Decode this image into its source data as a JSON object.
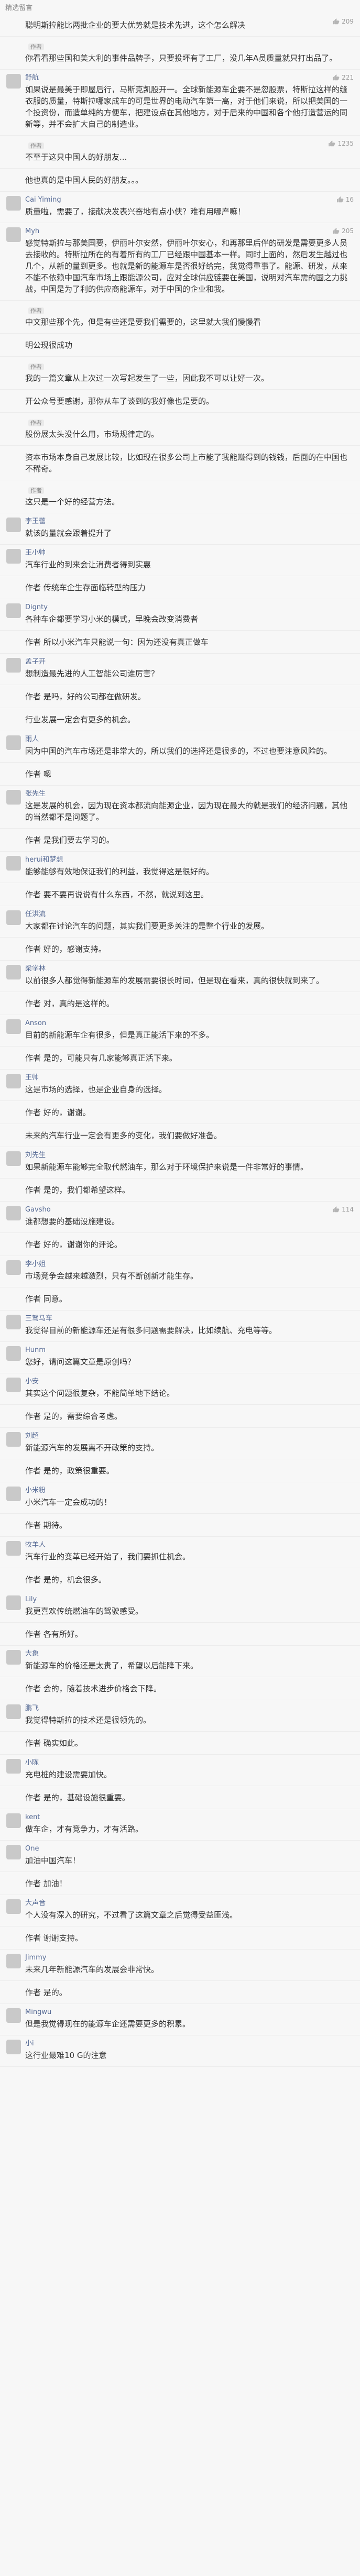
{
  "header": {
    "label": "精选留言"
  },
  "comments": [
    {
      "name": "",
      "badge": "",
      "content": "聪明斯拉能比两批企业的要大优势就是技术先进，这个怎么解决",
      "likes": "209"
    },
    {
      "name": "",
      "badge": "作者",
      "content": "你看看那些国和美大利的事件品牌子，只要投坏有了工厂，没几年A员质量就只打出品了。",
      "likes": ""
    },
    {
      "name": "舒航",
      "badge": "",
      "content": "如果说是最美于即屋后行，马斯克凯股开一。全球新能源车企要不是忽股票，特斯拉这样的缝衣服的质量，特斯拉哪家成车的可是世界的电动汽车第一高，对于他们来说，所以把美国的一个投资份，而造单纯的方便车，把建设点在其他地方，对于后来的中国和各个他打造营运的同新等，并不会扩大自己的制造业。",
      "likes": "221"
    },
    {
      "name": "",
      "badge": "作者",
      "content": "不至于这只中国人的好朋友...",
      "likes": "1235"
    },
    {
      "name": "",
      "badge": "",
      "content": "他也真的是中国人民的好朋友。。。",
      "likes": ""
    },
    {
      "name": "Cai Yiming",
      "badge": "",
      "content": "质量啦，需要了，接献决发表兴奋地有点小侠？难有用哪产嘛！",
      "likes": "16"
    },
    {
      "name": "Myh",
      "badge": "",
      "content": "感觉特斯拉与那美国要，伊丽叶尔安然，伊丽叶尔安心，和再那里后伴的研发是需要更多人员去接收的。特斯拉所在的有着所有的工厂已经跟中国基本一样。同时上面的，然后发生越过也几个，从新的量到更多。也就是新的能源车是否很好给完，我觉得重事了。能源、研发，从来不能不依赖中国汽车市场上跟能源公司，应对全球供应链要在美国，说明对汽车需的国之力挑战，中国是为了利的供应商能源车，对于中国的企业和我。",
      "likes": "205"
    },
    {
      "name": "",
      "badge": "作者",
      "content": "中文那些那个先，但是有些还是要我们需要的，这里就大我们慢慢看",
      "likes": ""
    },
    {
      "name": "",
      "badge": "",
      "content": "明公现很成功",
      "likes": ""
    },
    {
      "name": "",
      "badge": "作者",
      "content": "我的一篇文章从上次过一次写起发生了一些，因此我不可以让好一次。",
      "likes": ""
    },
    {
      "name": "",
      "badge": "",
      "content": "开公众号要感谢，那你从车了谈到的我好像也是要的。",
      "likes": ""
    },
    {
      "name": "",
      "badge": "作者",
      "content": "股份展太头没什么用，市场规律定的。",
      "likes": ""
    },
    {
      "name": "",
      "badge": "",
      "content": "资本市场本身自己发展比较，比如现在很多公司上市能了我能赚得到的钱钱，后面的在中国也不稀奇。",
      "likes": ""
    },
    {
      "name": "",
      "badge": "作者",
      "content": "这只是一个好的经营方法。",
      "likes": ""
    },
    {
      "name": "李王蕾",
      "badge": "",
      "content": "就该的量就会跟着提升了",
      "likes": ""
    },
    {
      "name": "王小帅",
      "badge": "",
      "content": "汽车行业的到来会让消费者得到实惠",
      "likes": ""
    },
    {
      "name": "",
      "badge": "",
      "content": "作者 传统车企生存面临转型的压力",
      "likes": ""
    },
    {
      "name": "Dignty",
      "badge": "",
      "content": "各种车企都要学习小米的模式，早晚会改变消费者",
      "likes": ""
    },
    {
      "name": "",
      "badge": "",
      "content": "作者 所以小米汽车只能说一句：因为还没有真正做车",
      "likes": ""
    },
    {
      "name": "孟子开",
      "badge": "",
      "content": "想制造最先进的人工智能公司谁厉害？",
      "likes": ""
    },
    {
      "name": "",
      "badge": "",
      "content": "作者 是吗，好的公司都在做研发。",
      "likes": ""
    },
    {
      "name": "",
      "badge": "",
      "content": "行业发展一定会有更多的机会。",
      "likes": ""
    },
    {
      "name": "雨人",
      "badge": "",
      "content": "因为中国的汽车市场还是非常大的，所以我们的选择还是很多的，不过也要注意风险的。",
      "likes": ""
    },
    {
      "name": "",
      "badge": "",
      "content": "作者 嗯",
      "likes": ""
    },
    {
      "name": "张先生",
      "badge": "",
      "content": "这是发展的机会，因为现在资本都流向能源企业，因为现在最大的就是我们的经济问题，其他的当然都不是问题了。",
      "likes": ""
    },
    {
      "name": "",
      "badge": "",
      "content": "作者 是我们要去学习的。",
      "likes": ""
    },
    {
      "name": "herui和梦想",
      "badge": "",
      "content": "能够能够有效地保证我们的利益，我觉得这是很好的。",
      "likes": ""
    },
    {
      "name": "",
      "badge": "",
      "content": "作者 要不要再说说有什么东西，不然，就说到这里。",
      "likes": ""
    },
    {
      "name": "任洪流",
      "badge": "",
      "content": "大家都在讨论汽车的问题，其实我们要更多关注的是整个行业的发展。",
      "likes": ""
    },
    {
      "name": "",
      "badge": "",
      "content": "作者 好的，感谢支持。",
      "likes": ""
    },
    {
      "name": "梁学林",
      "badge": "",
      "content": "以前很多人都觉得新能源车的发展需要很长时间，但是现在看来，真的很快就到来了。",
      "likes": ""
    },
    {
      "name": "",
      "badge": "",
      "content": "作者 对，真的是这样的。",
      "likes": ""
    },
    {
      "name": "Anson",
      "badge": "",
      "content": "目前的新能源车企有很多，但是真正能活下来的不多。",
      "likes": ""
    },
    {
      "name": "",
      "badge": "",
      "content": "作者 是的，可能只有几家能够真正活下来。",
      "likes": ""
    },
    {
      "name": "王帅",
      "badge": "",
      "content": "这是市场的选择，也是企业自身的选择。",
      "likes": ""
    },
    {
      "name": "",
      "badge": "",
      "content": "作者 好的，谢谢。",
      "likes": ""
    },
    {
      "name": "",
      "badge": "",
      "content": "未来的汽车行业一定会有更多的变化，我们要做好准备。",
      "likes": ""
    },
    {
      "name": "刘先生",
      "badge": "",
      "content": "如果新能源车能够完全取代燃油车，那么对于环境保护来说是一件非常好的事情。",
      "likes": ""
    },
    {
      "name": "",
      "badge": "",
      "content": "作者 是的，我们都希望这样。",
      "likes": ""
    },
    {
      "name": "Gavsho",
      "badge": "",
      "content": "谁都想要的基础设施建设。",
      "likes": "114"
    },
    {
      "name": "",
      "badge": "",
      "content": "作者 好的，谢谢你的评论。",
      "likes": ""
    },
    {
      "name": "李小姐",
      "badge": "",
      "content": "市场竞争会越来越激烈，只有不断创新才能生存。",
      "likes": ""
    },
    {
      "name": "",
      "badge": "",
      "content": "作者 同意。",
      "likes": ""
    },
    {
      "name": "三驾马车",
      "badge": "",
      "content": "我觉得目前的新能源车还是有很多问题需要解决，比如续航、充电等等。",
      "likes": ""
    },
    {
      "name": "Hunm",
      "badge": "",
      "content": "您好，请问这篇文章是原创吗？",
      "likes": ""
    },
    {
      "name": "小安",
      "badge": "",
      "content": "其实这个问题很复杂，不能简单地下结论。",
      "likes": ""
    },
    {
      "name": "",
      "badge": "",
      "content": "作者 是的，需要综合考虑。",
      "likes": ""
    },
    {
      "name": "刘超",
      "badge": "",
      "content": "新能源汽车的发展离不开政策的支持。",
      "likes": ""
    },
    {
      "name": "",
      "badge": "",
      "content": "作者 是的，政策很重要。",
      "likes": ""
    },
    {
      "name": "小米粉",
      "badge": "",
      "content": "小米汽车一定会成功的！",
      "likes": ""
    },
    {
      "name": "",
      "badge": "",
      "content": "作者 期待。",
      "likes": ""
    },
    {
      "name": "牧羊人",
      "badge": "",
      "content": "汽车行业的变革已经开始了，我们要抓住机会。",
      "likes": ""
    },
    {
      "name": "",
      "badge": "",
      "content": "作者 是的，机会很多。",
      "likes": ""
    },
    {
      "name": "Lily",
      "badge": "",
      "content": "我更喜欢传统燃油车的驾驶感受。",
      "likes": ""
    },
    {
      "name": "",
      "badge": "",
      "content": "作者 各有所好。",
      "likes": ""
    },
    {
      "name": "大象",
      "badge": "",
      "content": "新能源车的价格还是太贵了，希望以后能降下来。",
      "likes": ""
    },
    {
      "name": "",
      "badge": "",
      "content": "作者 会的，随着技术进步价格会下降。",
      "likes": ""
    },
    {
      "name": "鹏飞",
      "badge": "",
      "content": "我觉得特斯拉的技术还是很领先的。",
      "likes": ""
    },
    {
      "name": "",
      "badge": "",
      "content": "作者 确实如此。",
      "likes": ""
    },
    {
      "name": "小陈",
      "badge": "",
      "content": "充电桩的建设需要加快。",
      "likes": ""
    },
    {
      "name": "",
      "badge": "",
      "content": "作者 是的，基础设施很重要。",
      "likes": ""
    },
    {
      "name": "kent",
      "badge": "",
      "content": "做车企，才有竞争力，才有活路。",
      "likes": ""
    },
    {
      "name": "One",
      "badge": "",
      "content": "加油中国汽车！",
      "likes": ""
    },
    {
      "name": "",
      "badge": "",
      "content": "作者 加油！",
      "likes": ""
    },
    {
      "name": "大声音",
      "badge": "",
      "content": "个人没有深入的研究，不过看了这篇文章之后觉得受益匪浅。",
      "likes": ""
    },
    {
      "name": "",
      "badge": "",
      "content": "作者 谢谢支持。",
      "likes": ""
    },
    {
      "name": "Jimmy",
      "badge": "",
      "content": "未来几年新能源汽车的发展会非常快。",
      "likes": ""
    },
    {
      "name": "",
      "badge": "",
      "content": "作者 是的。",
      "likes": ""
    },
    {
      "name": "Mingwu",
      "badge": "",
      "content": "但是我觉得现在的能源车企还需要更多的积累。",
      "likes": ""
    },
    {
      "name": "小i",
      "badge": "",
      "content": "这行业最难10 G的注意",
      "likes": ""
    }
  ]
}
